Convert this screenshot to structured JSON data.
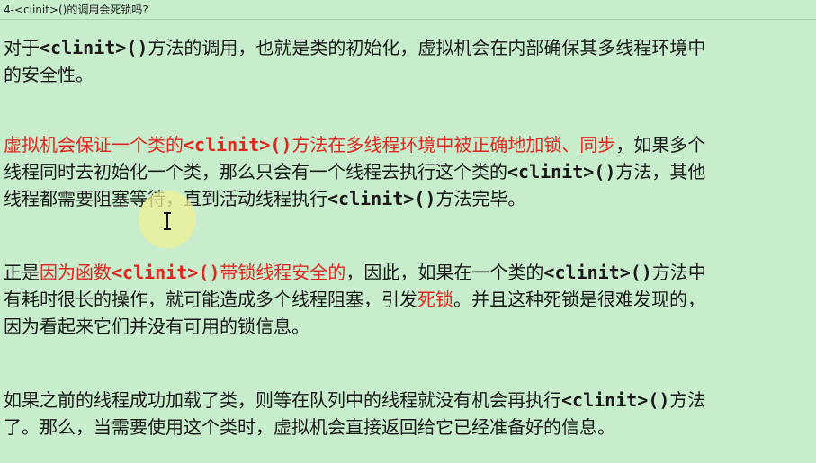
{
  "title": "4-<clinit>()的调用会死锁吗?",
  "p1": {
    "l1a": "对于",
    "l1code": "<clinit>()",
    "l1b": "方法的调用，也就是类的初始化，虚拟机会在内部确保其多线程环境中",
    "l2": "的安全性。"
  },
  "p2": {
    "l1red1": "虚拟机会保证一个类的",
    "l1code": "<clinit>()",
    "l1red2": "方法在多线程环境中被正确地加锁、同步",
    "l1b": "，如果多个",
    "l2a": "线程同时去初始化一个类，那么只会有一个线程去执行这个类的",
    "l2code": "<clinit>()",
    "l2b": "方法，其他",
    "l3a": "线程都需要阻塞等待，直到活动线程执行",
    "l3code": "<clinit>()",
    "l3b": "方法完毕。"
  },
  "p3": {
    "l1a": "正是",
    "l1red1": "因为函数",
    "l1code": "<clinit>()",
    "l1red2": "带锁线程安全的",
    "l1b": "，因此，如果在一个类的",
    "l1code2": "<clinit>()",
    "l1c": "方法中",
    "l2a": "有耗时很长的操作，就可能造成多个线程阻塞，引发",
    "l2red": "死锁",
    "l2b": "。并且这种死锁是很难发现的，",
    "l3": "因为看起来它们并没有可用的锁信息。"
  },
  "p4": {
    "l1a": "如果之前的线程成功加载了类，则等在队列中的线程就没有机会再执行",
    "l1code": "<clinit>()",
    "l1b": "方法",
    "l2": "了。那么，当需要使用这个类时，虚拟机会直接返回给它已经准备好的信息。"
  },
  "colors": {
    "background": "#c7edcc",
    "highlight_text": "#e0261f",
    "text": "#1a1a1a"
  },
  "cursor": "text-cursor-icon"
}
